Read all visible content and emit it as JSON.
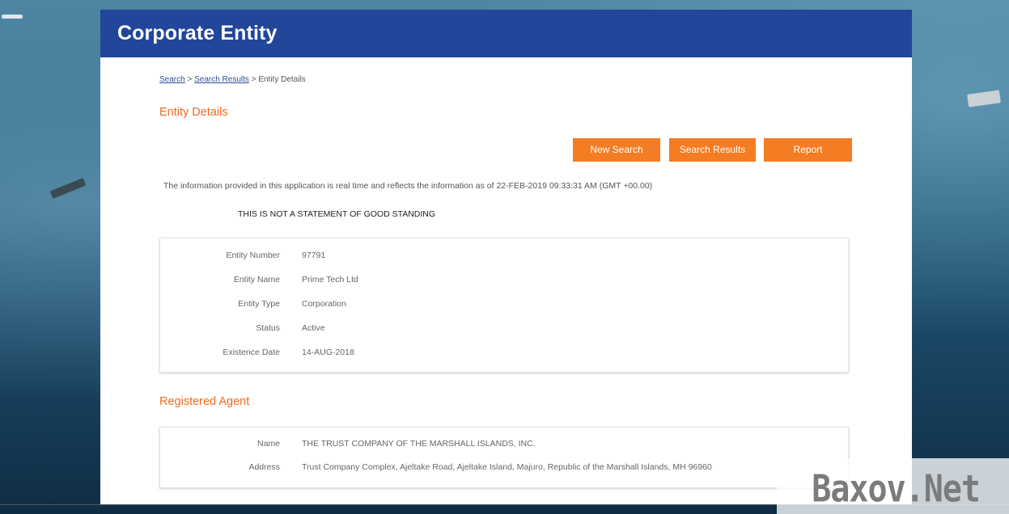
{
  "header": {
    "title": "Corporate Entity"
  },
  "breadcrumb": {
    "search": "Search",
    "sep1": " > ",
    "search_results": "Search Results",
    "sep2": " > ",
    "current": "Entity Details"
  },
  "entity_section": {
    "title": "Entity Details"
  },
  "buttons": {
    "new_search": "New Search",
    "search_results": "Search Results",
    "report": "Report"
  },
  "info_text": "The information provided in this application is real time and reflects the information as of 22-FEB-2019 09:33:31 AM (GMT +00.00)",
  "warning_text": "THIS IS NOT A STATEMENT OF GOOD STANDING",
  "entity_details": [
    {
      "label": "Entity Number",
      "value": "97791"
    },
    {
      "label": "Entity Name",
      "value": "Prime Tech Ltd"
    },
    {
      "label": "Entity Type",
      "value": "Corporation"
    },
    {
      "label": "Status",
      "value": "Active"
    },
    {
      "label": "Existence Date",
      "value": "14-AUG-2018"
    }
  ],
  "agent_section": {
    "title": "Registered Agent"
  },
  "agent_details": [
    {
      "label": "Name",
      "value": "THE TRUST COMPANY OF THE MARSHALL ISLANDS, INC."
    },
    {
      "label": "Address",
      "value": "Trust Company Complex, Ajeltake Road, Ajeltake Island, Majuro, Republic of the Marshall Islands, MH 96960"
    }
  ],
  "watermark": "Baxov.Net",
  "colors": {
    "header_bg": "#21469a",
    "accent_orange": "#f47c22",
    "section_title": "#f06a1c"
  }
}
